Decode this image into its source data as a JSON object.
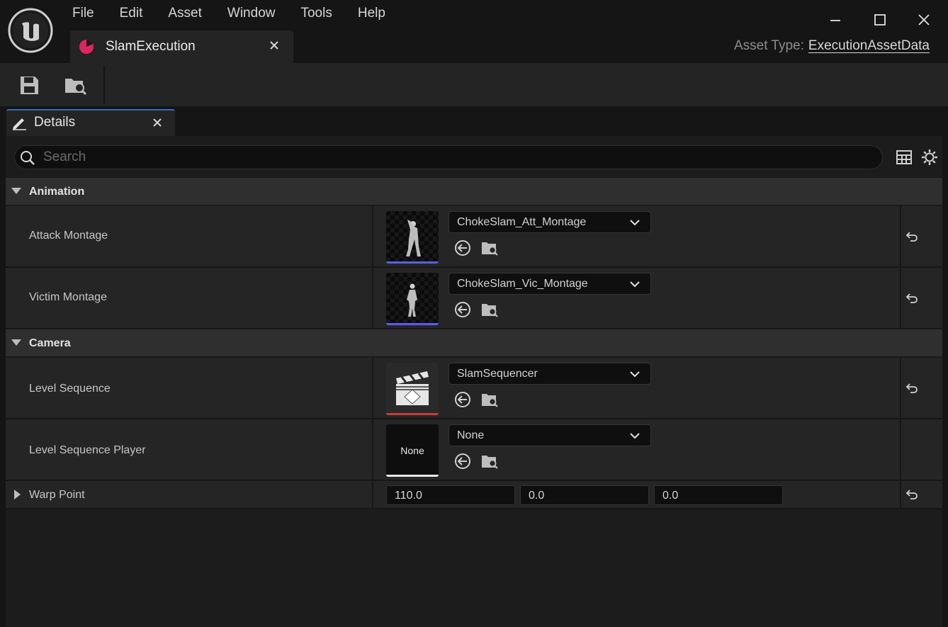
{
  "menu": {
    "items": [
      {
        "label": "File"
      },
      {
        "label": "Edit"
      },
      {
        "label": "Asset"
      },
      {
        "label": "Window"
      },
      {
        "label": "Tools"
      },
      {
        "label": "Help"
      }
    ]
  },
  "document_tab": {
    "title": "SlamExecution",
    "icon": "pie-chart-icon",
    "accent": "#e0245e"
  },
  "asset_type": {
    "label": "Asset Type:",
    "value": "ExecutionAssetData"
  },
  "toolbar": {
    "buttons": [
      "save-icon",
      "browse-folder-icon"
    ]
  },
  "details_tab": {
    "title": "Details",
    "accent": "#2f6fbf"
  },
  "search": {
    "placeholder": "Search",
    "value": ""
  },
  "categories": {
    "animation": {
      "label": "Animation",
      "rows": [
        {
          "name": "Attack Montage",
          "value": "ChokeSlam_Att_Montage",
          "bar_color": "#5b5bff"
        },
        {
          "name": "Victim Montage",
          "value": "ChokeSlam_Vic_Montage",
          "bar_color": "#5b5bff"
        }
      ]
    },
    "camera": {
      "label": "Camera",
      "rows": [
        {
          "name": "Level Sequence",
          "value": "SlamSequencer",
          "bar_color": "#d0383b"
        },
        {
          "name": "Level Sequence Player",
          "value": "None",
          "thumb_text": "None",
          "bar_color": "#e8e8e8"
        },
        {
          "name": "Warp Point",
          "x": "110.0",
          "y": "0.0",
          "z": "0.0"
        }
      ]
    }
  }
}
